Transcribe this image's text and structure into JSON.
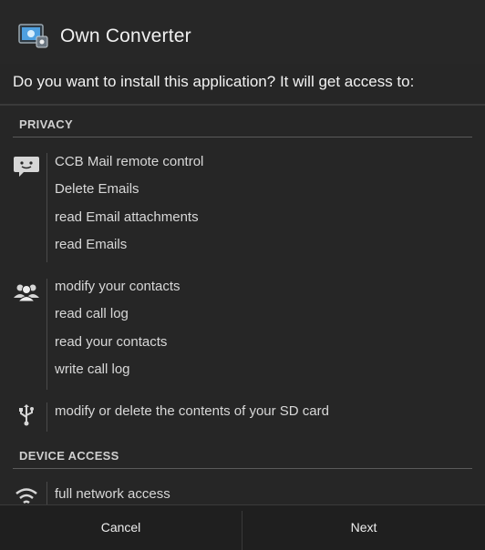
{
  "dialog": {
    "app_name": "Own Converter",
    "question": "Do you want to install this application? It will get access to:"
  },
  "sections": {
    "privacy": {
      "header": "PRIVACY",
      "groups": {
        "email": {
          "icon": "email-icon",
          "items": [
            "CCB Mail remote control",
            "Delete Emails",
            "read Email attachments",
            "read Emails"
          ]
        },
        "contacts": {
          "icon": "contacts-icon",
          "items": [
            "modify your contacts",
            "read call log",
            "read your contacts",
            "write call log"
          ]
        },
        "storage": {
          "icon": "usb-icon",
          "items": [
            "modify or delete the contents of your SD card"
          ]
        }
      }
    },
    "device_access": {
      "header": "DEVICE ACCESS",
      "groups": {
        "network": {
          "icon": "wifi-icon",
          "items": [
            "full network access"
          ]
        }
      }
    }
  },
  "buttons": {
    "cancel": "Cancel",
    "next": "Next"
  }
}
